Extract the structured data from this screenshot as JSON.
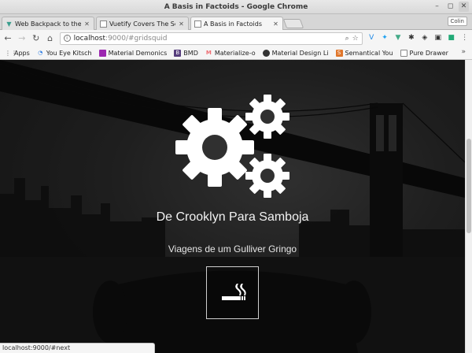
{
  "window": {
    "title": "A Basis in Factoids - Google Chrome",
    "close_label": "✕"
  },
  "tabs": [
    {
      "label": "Web Backpack to the",
      "favicon": "vuetify-icon",
      "close": "✕"
    },
    {
      "label": "Vuetify Covers The Se",
      "favicon": "page-icon",
      "close": "✕"
    },
    {
      "label": "A Basis in Factoids",
      "favicon": "page-icon",
      "close": "✕"
    }
  ],
  "profile": "Colin",
  "nav": {
    "back": "←",
    "forward": "→",
    "reload": "↻",
    "home": "⌂"
  },
  "omnibox": {
    "host": "localhost",
    "rest": ":9000/#gridsquid"
  },
  "bookmarks": [
    {
      "label": "Apps",
      "icon": "apps-grid-icon"
    },
    {
      "label": "You Eye Kitsch",
      "icon": "loader-icon"
    },
    {
      "label": "Material Demonics",
      "icon": "material-icon"
    },
    {
      "label": "BMD",
      "icon": "bootstrap-icon"
    },
    {
      "label": "Materialize-o",
      "icon": "materialize-icon"
    },
    {
      "label": "Material Design Li",
      "icon": "github-icon"
    },
    {
      "label": "Semantical You",
      "icon": "semantic-icon"
    },
    {
      "label": "Pure Drawer",
      "icon": "page-icon"
    }
  ],
  "bookmarks_more": "»",
  "hero": {
    "title": "De Crooklyn Para Samboja",
    "subtitle": "Viagens de um Gulliver Gringo",
    "button_icon": "smoking-icon"
  },
  "status": "localhost:9000/#next",
  "colors": {
    "overlay": "#262626",
    "text": "#f2f2f2"
  }
}
